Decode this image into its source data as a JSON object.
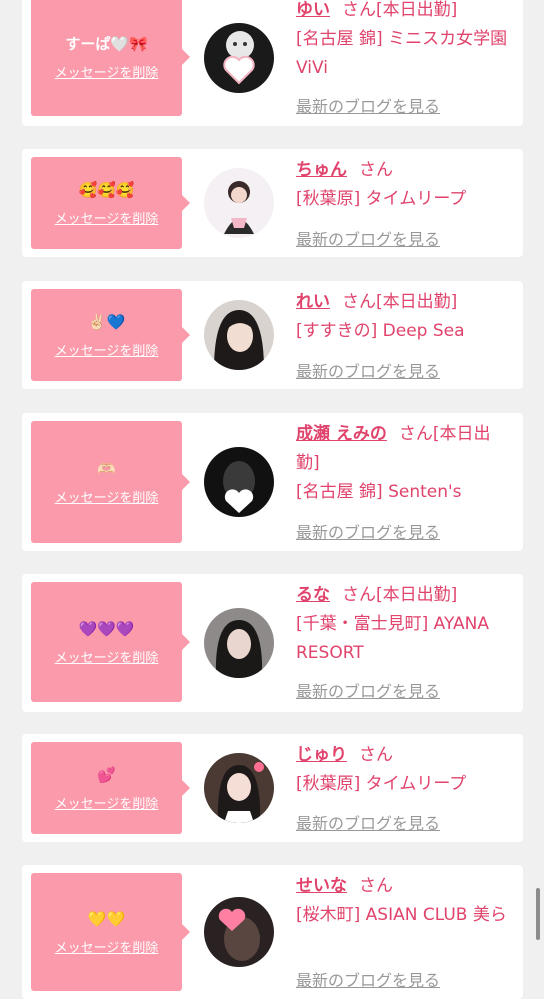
{
  "cards": [
    {
      "message": "すーぱ🤍🎀",
      "delete": "メッセージを削除",
      "name": "ゆい",
      "san": "さん",
      "status": "[本日出勤]",
      "shop": "[名古屋 錦] ミニスカ女学園ViVi",
      "blog": "最新のブログを見る",
      "avatar": "white-cat-heart"
    },
    {
      "message": "🥰🥰🥰",
      "delete": "メッセージを削除",
      "name": "ちゅん",
      "san": "さん",
      "status": "",
      "shop": "[秋葉原] タイムリープ",
      "blog": "最新のブログを見る",
      "avatar": "girl-light"
    },
    {
      "message": "✌🏻💙",
      "delete": "メッセージを削除",
      "name": "れい",
      "san": "さん",
      "status": "[本日出勤]",
      "shop": "[すすきの] Deep Sea",
      "blog": "最新のブログを見る",
      "avatar": "girl-dark-hair"
    },
    {
      "message": "🫶🏻",
      "delete": "メッセージを削除",
      "name": "成瀬 えみの",
      "san": "さん",
      "status": "[本日出勤]",
      "shop": "[名古屋 錦] Senten's",
      "blog": "最新のブログを見る",
      "avatar": "girl-black-heart"
    },
    {
      "message": "💜💜💜",
      "delete": "メッセージを削除",
      "name": "るな",
      "san": "さん",
      "status": "[本日出勤]",
      "shop": "[千葉・富士見町] AYANA RESORT",
      "blog": "最新のブログを見る",
      "avatar": "girl-grey"
    },
    {
      "message": "💕",
      "delete": "メッセージを削除",
      "name": "じゅり",
      "san": "さん",
      "status": "",
      "shop": "[秋葉原] タイムリープ",
      "blog": "最新のブログを見る",
      "avatar": "girl-maid"
    },
    {
      "message": "💛💛",
      "delete": "メッセージを削除",
      "name": "せいな",
      "san": "さん",
      "status": "",
      "shop": "[桜木町] ASIAN CLUB 美ら",
      "blog": "最新のブログを見る",
      "avatar": "girl-pink-heart"
    }
  ]
}
